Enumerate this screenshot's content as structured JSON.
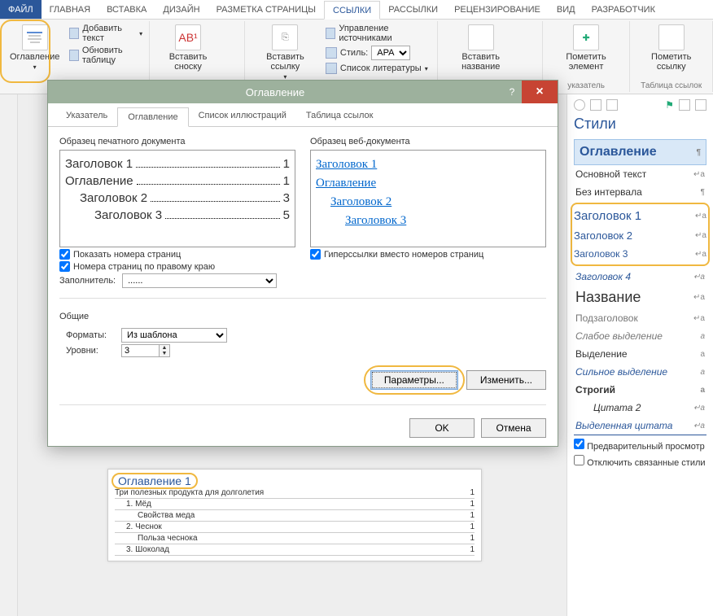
{
  "ribbon": {
    "tabs": [
      "ФАЙЛ",
      "ГЛАВНАЯ",
      "ВСТАВКА",
      "ДИЗАЙН",
      "РАЗМЕТКА СТРАНИЦЫ",
      "ССЫЛКИ",
      "РАССЫЛКИ",
      "РЕЦЕНЗИРОВАНИЕ",
      "ВИД",
      "РАЗРАБОТЧИК"
    ],
    "active_tab": "ССЫЛКИ",
    "group_toc": {
      "big": "Оглавление",
      "add_text": "Добавить текст",
      "update_table": "Обновить таблицу"
    },
    "group_footnote": {
      "big": "Вставить сноску"
    },
    "group_insert": {
      "big": "Вставить ссылку"
    },
    "group_citation": {
      "manage_sources": "Управление источниками",
      "style_label": "Стиль:",
      "style_value": "APA",
      "biblio": "Список литературы"
    },
    "group_caption": {
      "big": "Вставить название"
    },
    "group_index": {
      "big": "Пометить элемент",
      "footer": "указатель"
    },
    "group_toa": {
      "big": "Пометить ссылку",
      "footer": "Таблица ссылок"
    }
  },
  "dialog": {
    "title": "Оглавление",
    "tabs": [
      "Указатель",
      "Оглавление",
      "Список иллюстраций",
      "Таблица ссылок"
    ],
    "active_tab": "Оглавление",
    "print_preview_label": "Образец печатного документа",
    "web_preview_label": "Образец веб-документа",
    "print_entries": [
      {
        "name": "Заголовок 1",
        "page": "1",
        "indent": 0
      },
      {
        "name": "Оглавление",
        "page": "1",
        "indent": 0
      },
      {
        "name": "Заголовок 2",
        "page": "3",
        "indent": 1
      },
      {
        "name": "Заголовок 3",
        "page": "5",
        "indent": 2
      }
    ],
    "web_entries": [
      {
        "name": "Заголовок 1",
        "indent": 0
      },
      {
        "name": "Оглавление",
        "indent": 0
      },
      {
        "name": "Заголовок 2",
        "indent": 1
      },
      {
        "name": "Заголовок 3",
        "indent": 2
      }
    ],
    "chk_show_pages": "Показать номера страниц",
    "chk_right_align": "Номера страниц по правому краю",
    "chk_hyperlinks": "Гиперссылки вместо номеров страниц",
    "leader_label": "Заполнитель:",
    "leader_value": "......",
    "general_label": "Общие",
    "formats_label": "Форматы:",
    "formats_value": "Из шаблона",
    "levels_label": "Уровни:",
    "levels_value": "3",
    "btn_options": "Параметры...",
    "btn_modify": "Изменить...",
    "btn_ok": "OK",
    "btn_cancel": "Отмена"
  },
  "styles_pane": {
    "title": "Стили",
    "items": [
      {
        "label": "Оглавление",
        "cls": "current",
        "mark": "¶"
      },
      {
        "label": "Основной текст",
        "cls": "",
        "mark": "↵a"
      },
      {
        "label": "Без интервала",
        "cls": "",
        "mark": "¶"
      },
      {
        "label": "Заголовок 1",
        "cls": "h1",
        "mark": "↵a"
      },
      {
        "label": "Заголовок 2",
        "cls": "h2",
        "mark": "↵a"
      },
      {
        "label": "Заголовок 3",
        "cls": "h3",
        "mark": "↵a"
      },
      {
        "label": "Заголовок 4",
        "cls": "h4",
        "mark": "↵a"
      },
      {
        "label": "Название",
        "cls": "title",
        "mark": "↵a"
      },
      {
        "label": "Подзаголовок",
        "cls": "sub",
        "mark": "↵a"
      },
      {
        "label": "Слабое выделение",
        "cls": "emph",
        "mark": "a"
      },
      {
        "label": "Выделение",
        "cls": "",
        "mark": "a"
      },
      {
        "label": "Сильное выделение",
        "cls": "strongemph",
        "mark": "a"
      },
      {
        "label": "Строгий",
        "cls": "",
        "mark": "a",
        "bold": true
      },
      {
        "label": "Цитата 2",
        "cls": "quote",
        "mark": "↵a"
      },
      {
        "label": "Выделенная цитата",
        "cls": "selected-quote",
        "mark": "↵a"
      }
    ],
    "chk_preview": "Предварительный просмотр",
    "chk_disable_linked": "Отключить связанные стили"
  },
  "doc_toc": {
    "title": "Оглавление 1",
    "rows": [
      {
        "t": "Три полезных продукта для долголетия",
        "p": "1",
        "i": 0
      },
      {
        "t": "1. Мёд",
        "p": "1",
        "i": 1
      },
      {
        "t": "Свойства меда",
        "p": "1",
        "i": 2
      },
      {
        "t": "2. Чеснок",
        "p": "1",
        "i": 1
      },
      {
        "t": "Польза чеснока",
        "p": "1",
        "i": 2
      },
      {
        "t": "3. Шоколад",
        "p": "1",
        "i": 1
      }
    ]
  }
}
